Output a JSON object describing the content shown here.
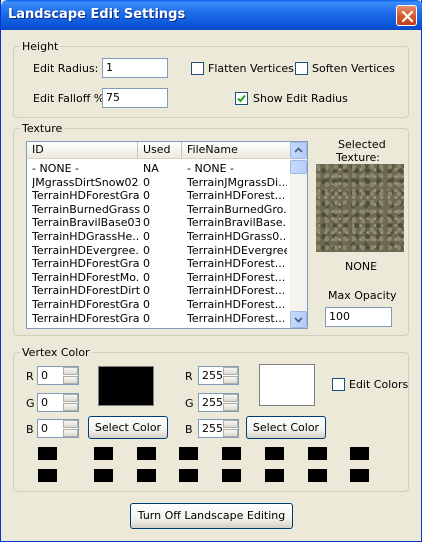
{
  "window": {
    "title": "Landscape Edit Settings",
    "close_icon": "close-icon",
    "title_bar_color": "#0A5FE8"
  },
  "height": {
    "legend": "Height",
    "edit_radius_label": "Edit Radius:",
    "edit_radius_value": "1",
    "edit_falloff_label": "Edit Falloff %:",
    "edit_falloff_value": "75",
    "flatten_label": "Flatten Vertices",
    "flatten_checked": false,
    "soften_label": "Soften Vertices",
    "soften_checked": false,
    "show_radius_label": "Show Edit Radius",
    "show_radius_checked": true
  },
  "texture": {
    "legend": "Texture",
    "columns": [
      "ID",
      "Used",
      "FileName"
    ],
    "rows": [
      [
        "- NONE -",
        "NA",
        "- NONE -"
      ],
      [
        "JMgrassDirtSnow02...",
        "0",
        "TerrainJMgrassDi..."
      ],
      [
        "TerrainHDForestGra...",
        "0",
        "TerrainHDForest..."
      ],
      [
        "TerrainBurnedGrass...",
        "0",
        "TerrainBurnedGro..."
      ],
      [
        "TerrainBravilBase03...",
        "0",
        "TerrainBravilBase..."
      ],
      [
        "TerrainHDGrassHe...",
        "0",
        "TerrainHDGrass0..."
      ],
      [
        "TerrainHDEvergree...",
        "0",
        "TerrainHDEvergree..."
      ],
      [
        "TerrainHDForestGra...",
        "0",
        "TerrainHDForest..."
      ],
      [
        "TerrainHDForestMo...",
        "0",
        "TerrainHDForest..."
      ],
      [
        "TerrainHDForestDirt...",
        "0",
        "TerrainHDForest..."
      ],
      [
        "TerrainHDForestGra...",
        "0",
        "TerrainHDForest..."
      ],
      [
        "TerrainHDForestGra...",
        "0",
        "TerrainHDForest..."
      ]
    ],
    "selected_label_line1": "Selected",
    "selected_label_line2": "Texture:",
    "selected_name": "NONE",
    "max_opacity_label": "Max Opacity",
    "max_opacity_value": "100"
  },
  "vertex_color": {
    "legend": "Vertex Color",
    "left": {
      "r": "0",
      "g": "0",
      "b": "0",
      "swatch_color": "#000000"
    },
    "right": {
      "r": "255",
      "g": "255",
      "b": "255",
      "swatch_color": "#FFFFFF"
    },
    "r_label": "R",
    "g_label": "G",
    "b_label": "B",
    "select_color_label": "Select Color",
    "edit_colors_label": "Edit Colors",
    "edit_colors_checked": false,
    "palette": [
      "#000000",
      "#000000",
      "#000000",
      "#000000",
      "#000000",
      "#000000",
      "#000000",
      "#000000",
      "#000000",
      "#000000",
      "#000000",
      "#000000",
      "#000000",
      "#000000",
      "#000000",
      "#000000"
    ]
  },
  "footer": {
    "toggle_button_label": "Turn Off Landscape Editing"
  }
}
